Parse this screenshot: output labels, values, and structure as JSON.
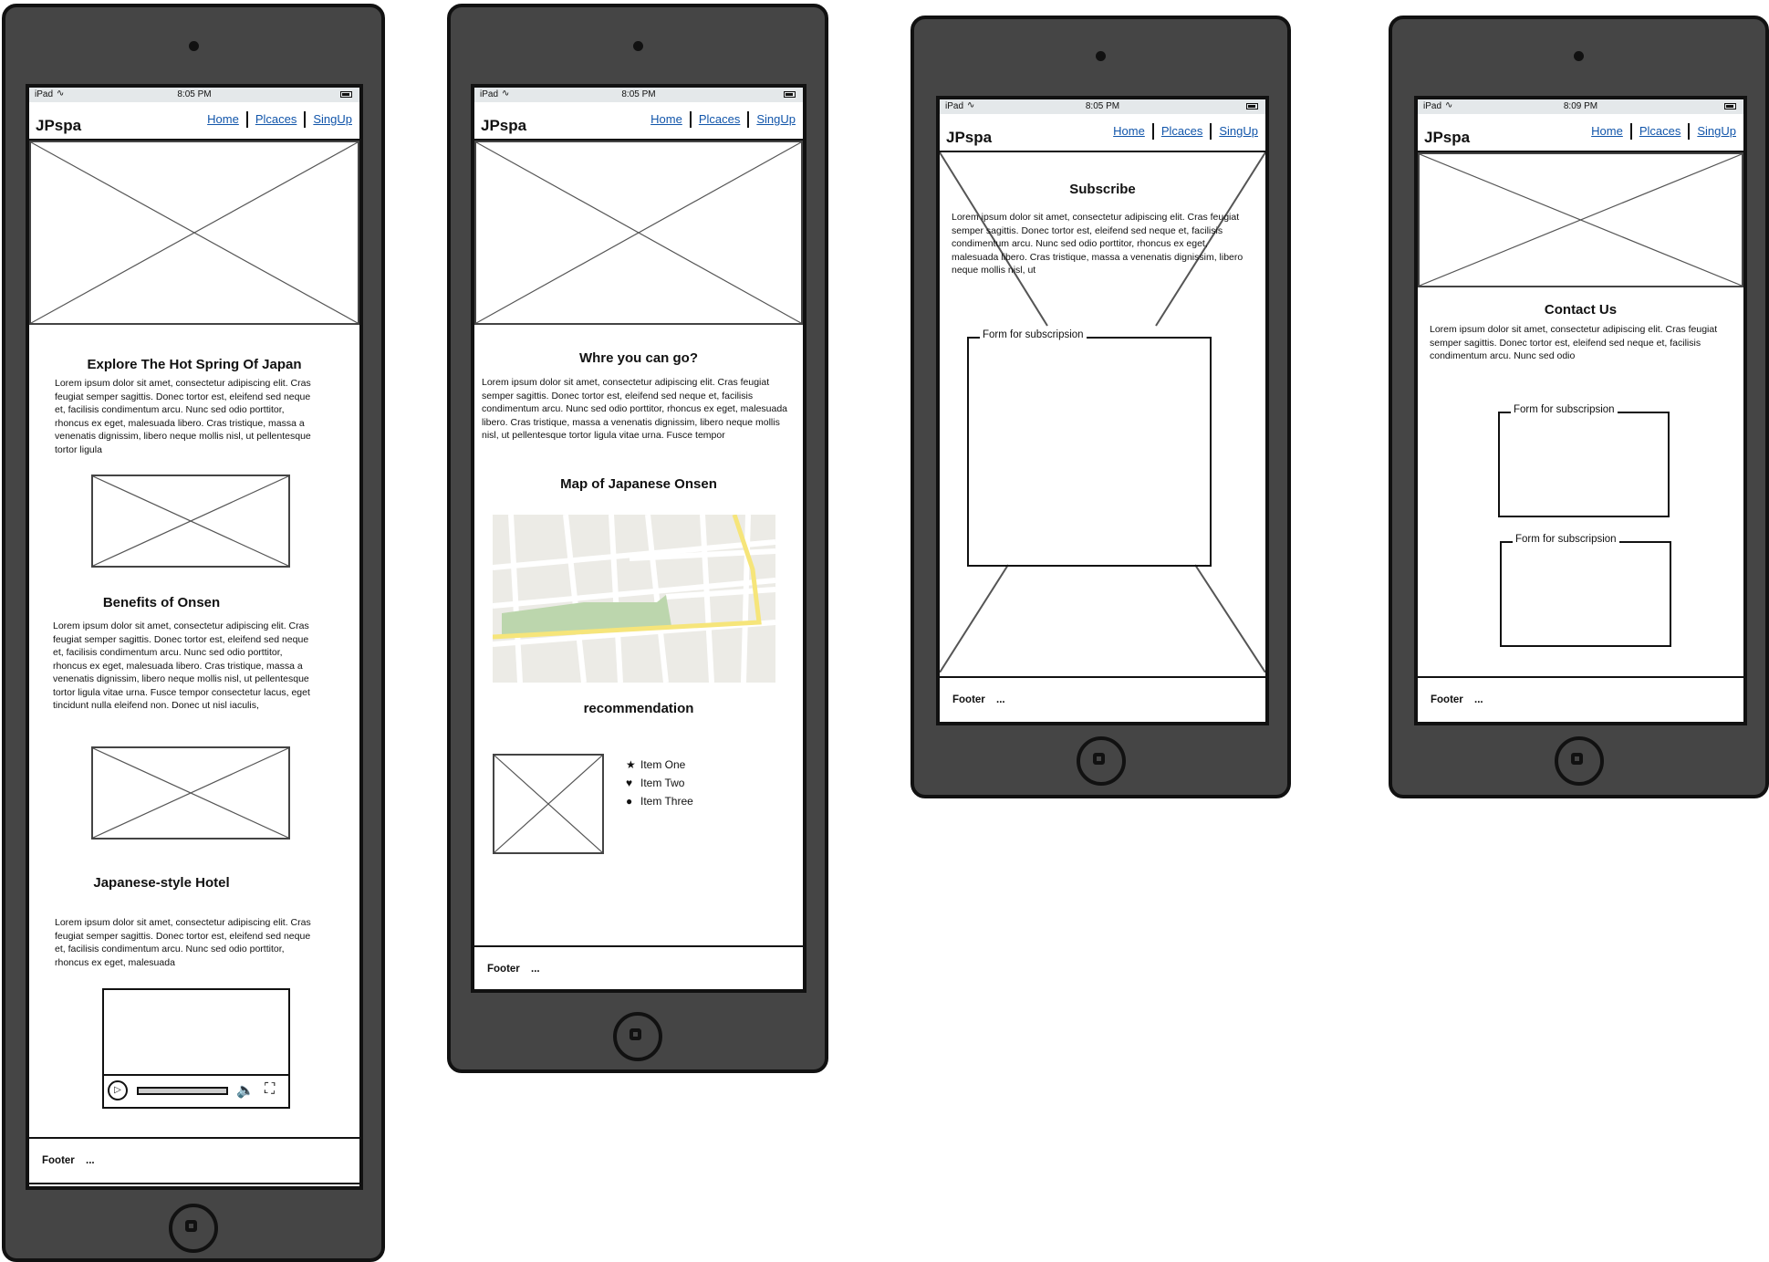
{
  "status": {
    "device": "iPad",
    "time_a": "8:05 PM",
    "time_b": "8:09 PM"
  },
  "nav": {
    "brand": "JPspa",
    "home": "Home",
    "places": "Plcaces",
    "signup": "SingUp"
  },
  "footer": {
    "label": "Footer",
    "dots": "..."
  },
  "lorem": {
    "p1": "Lorem ipsum dolor sit amet, consectetur adipiscing elit. Cras feugiat semper sagittis. Donec tortor est, eleifend sed neque et, facilisis condimentum arcu. Nunc sed odio porttitor, rhoncus ex eget, malesuada libero. Cras tristique, massa a venenatis dignissim, libero neque mollis nisl, ut pellentesque tortor ligula",
    "p2": "Lorem ipsum dolor sit amet, consectetur adipiscing elit. Cras feugiat semper sagittis. Donec tortor est, eleifend sed neque et, facilisis condimentum arcu. Nunc sed odio porttitor, rhoncus ex eget, malesuada libero. Cras tristique, massa a venenatis dignissim, libero neque mollis nisl, ut pellentesque tortor ligula vitae urna. Fusce tempor consectetur lacus, eget tincidunt nulla eleifend non. Donec ut nisl iaculis,",
    "p3": "Lorem ipsum dolor sit amet, consectetur adipiscing elit. Cras feugiat semper sagittis. Donec tortor est, eleifend sed neque et, facilisis condimentum arcu. Nunc sed odio porttitor, rhoncus ex eget, malesuada",
    "p4": "Lorem ipsum dolor sit amet, consectetur adipiscing elit. Cras feugiat semper sagittis. Donec tortor est, eleifend sed neque et, facilisis condimentum arcu. Nunc sed odio porttitor, rhoncus ex eget, malesuada libero. Cras tristique, massa a venenatis dignissim, libero neque mollis nisl, ut pellentesque tortor ligula vitae urna. Fusce tempor",
    "p5": "Lorem ipsum dolor sit amet, consectetur adipiscing elit. Cras feugiat semper sagittis. Donec tortor est, eleifend sed neque et, facilisis condimentum arcu. Nunc sed odio porttitor, rhoncus ex eget, malesuada libero. Cras tristique, massa a venenatis dignissim, libero neque mollis nisl, ut",
    "p6": "Lorem ipsum dolor sit amet, consectetur adipiscing elit. Cras feugiat semper sagittis. Donec tortor est, eleifend sed neque et, facilisis condimentum arcu. Nunc sed odio"
  },
  "screen1": {
    "title1": "Explore The Hot Spring Of Japan",
    "title2": "Benefits of Onsen",
    "title3": "Japanese-style Hotel"
  },
  "screen2": {
    "title1": "Whre you can go?",
    "title2": "Map of Japanese Onsen",
    "title3": "recommendation",
    "items": [
      {
        "label": "Item One",
        "icon": "star-icon"
      },
      {
        "label": "Item Two",
        "icon": "heart-icon"
      },
      {
        "label": "Item Three",
        "icon": "circle-icon"
      }
    ]
  },
  "screen3": {
    "title": "Subscribe",
    "form": "Form for subscripsion"
  },
  "screen4": {
    "title": "Contact Us",
    "form1": "Form for subscripsion",
    "form2": "Form for subscripsion"
  }
}
